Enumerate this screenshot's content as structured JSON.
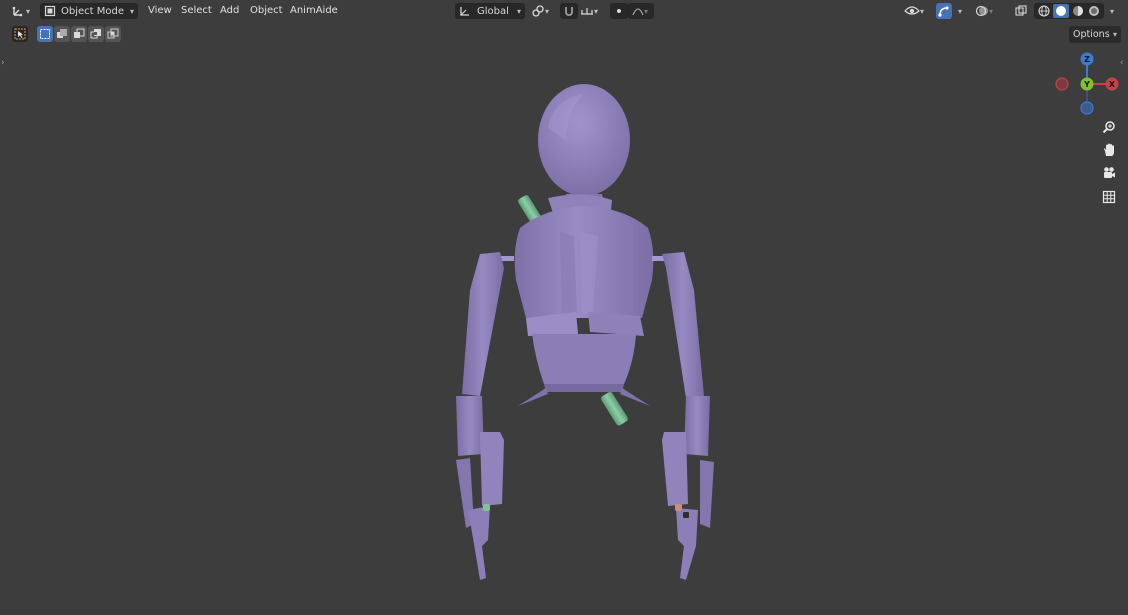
{
  "header": {
    "mode_label": "Object Mode",
    "menus": [
      "View",
      "Select",
      "Add",
      "Object",
      "AnimAide"
    ],
    "orientation_label": "Global"
  },
  "toolbar": {
    "options_label": "Options"
  },
  "gizmo": {
    "z_label": "Z",
    "y_label": "Y",
    "x_label": "X",
    "x_color": "#c8404a",
    "y_color": "#7fc22e",
    "z_color": "#3a7bd6"
  },
  "colors": {
    "background": "#3d3d3d",
    "model": "#8e80b8",
    "accent_green": "#6fae8a",
    "active_button": "#4772b3"
  }
}
